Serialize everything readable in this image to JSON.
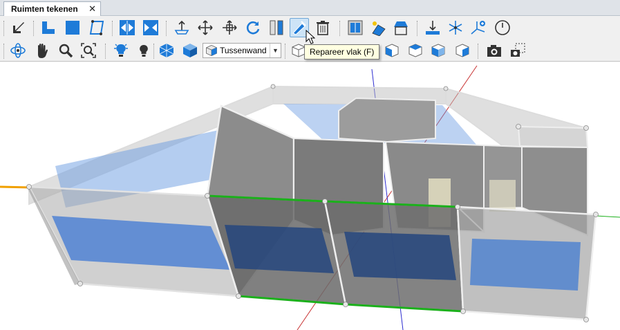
{
  "tab": {
    "title": "Ruimten tekenen",
    "close_glyph": "✕"
  },
  "toolbar_row1": [
    {
      "name": "select-arrow-icon"
    },
    {
      "name": "draw-l-room-icon"
    },
    {
      "name": "draw-rectangle-room-icon"
    },
    {
      "name": "draw-polygon-room-icon"
    },
    {
      "name": "mirror-horizontal-icon"
    },
    {
      "name": "mirror-vertical-icon"
    },
    {
      "name": "move-point-icon"
    },
    {
      "name": "move-icon"
    },
    {
      "name": "move-axis-icon"
    },
    {
      "name": "rotate-icon"
    },
    {
      "name": "split-wall-icon"
    },
    {
      "name": "repair-surface-icon"
    },
    {
      "name": "delete-icon"
    },
    {
      "name": "window-icon"
    },
    {
      "name": "solar-panel-icon"
    },
    {
      "name": "roof-icon"
    },
    {
      "name": "floor-level-icon"
    },
    {
      "name": "star-snap-icon"
    },
    {
      "name": "coordinate-axis-icon"
    },
    {
      "name": "clock-icon"
    }
  ],
  "toolbar_row2": [
    {
      "name": "orbit-icon"
    },
    {
      "name": "pan-hand-icon"
    },
    {
      "name": "zoom-icon"
    },
    {
      "name": "zoom-extents-icon"
    },
    {
      "name": "light-on-icon"
    },
    {
      "name": "light-off-icon"
    },
    {
      "name": "wireframe-cube-icon"
    },
    {
      "name": "shaded-cube-icon"
    },
    {
      "name": "view-front-icon"
    },
    {
      "name": "view-top-icon"
    },
    {
      "name": "view-right-icon"
    },
    {
      "name": "view-iso-left-icon"
    },
    {
      "name": "view-iso-right-icon"
    },
    {
      "name": "view-back-icon"
    },
    {
      "name": "view-bottom-icon"
    },
    {
      "name": "camera-icon"
    },
    {
      "name": "camera-region-icon"
    }
  ],
  "wall_type_select": {
    "value": "Tussenwand"
  },
  "tooltip": {
    "text": "Repareer vlak (F)"
  },
  "colors": {
    "accent_blue": "#1e7bd8",
    "wall_gray": "#8f8f8f",
    "floor_blue": "#4a7fd0",
    "edge_green": "#1bb01b",
    "axis_red": "#c83232",
    "axis_blue": "#2b2bd0",
    "axis_orange": "#f0a000"
  }
}
